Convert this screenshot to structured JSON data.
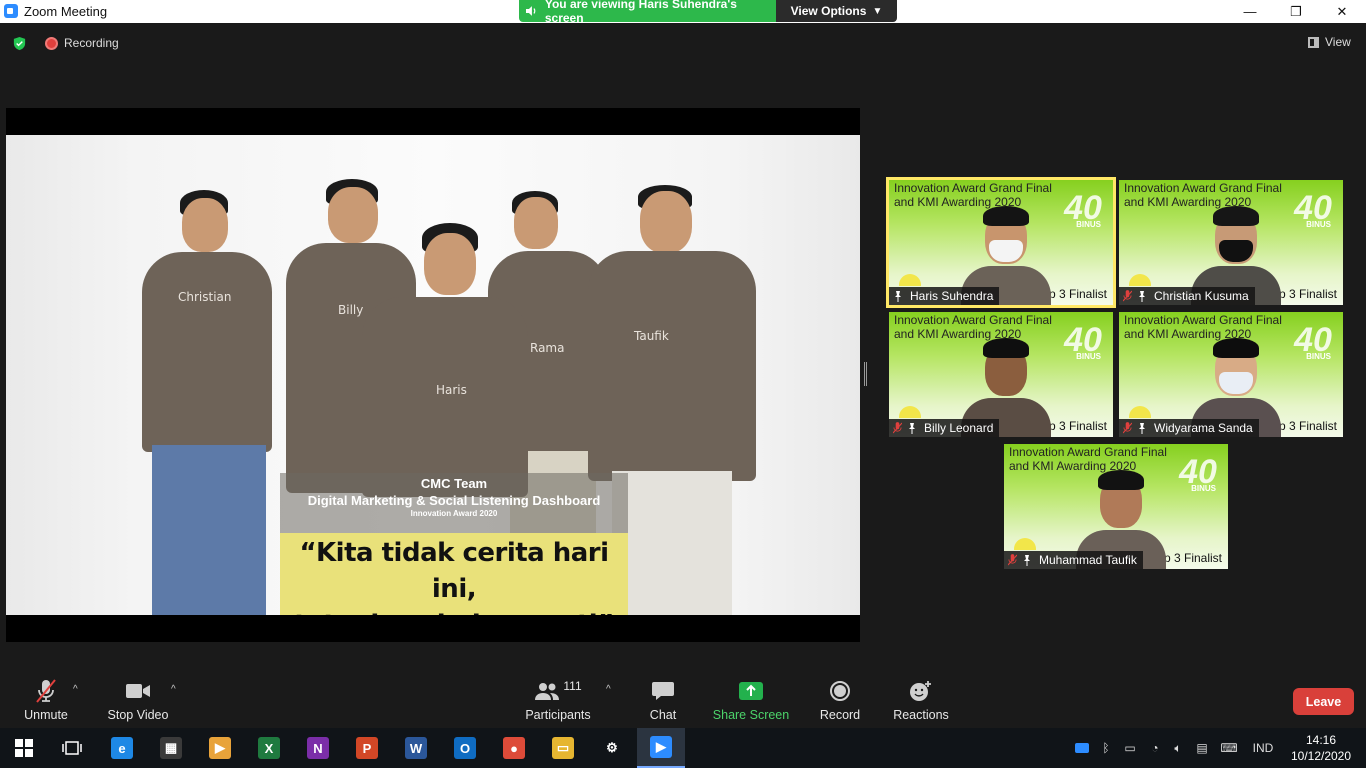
{
  "window": {
    "title": "Zoom Meeting",
    "controls": {
      "minimize": "—",
      "restore": "❐",
      "close": "✕"
    }
  },
  "share_banner": {
    "viewing_text": "You are viewing Haris Suhendra's screen",
    "view_options_label": "View Options",
    "caret": "⌄"
  },
  "status": {
    "recording_label": "Recording",
    "view_label": "View"
  },
  "shared_screen": {
    "people_labels": [
      "Christian",
      "Billy",
      "Haris",
      "Rama",
      "Taufik"
    ],
    "caption_line1": "CMC Team",
    "caption_line2": "Digital Marketing & Social Listening Dashboard",
    "caption_line3": "Innovation Award 2020",
    "quote_line1": "“Kita tidak cerita hari ini,",
    "quote_line2": "tetapi esok dan nanti”"
  },
  "tiles_common": {
    "bg_title_line1": "Innovation Award Grand Final",
    "bg_title_line2": "and KMI Awarding 2020",
    "logo": "40",
    "logo_sub": "BINUS",
    "finalist_text": "op 3 Finalist"
  },
  "participants_tiles": [
    {
      "name": "Haris Suhendra",
      "muted": false,
      "active": true
    },
    {
      "name": "Christian Kusuma",
      "muted": true,
      "active": false
    },
    {
      "name": "Billy Leonard",
      "muted": true,
      "active": false
    },
    {
      "name": "Widyarama Sanda",
      "muted": true,
      "active": false
    },
    {
      "name": "Muhammad Taufik",
      "muted": true,
      "active": false
    }
  ],
  "toolbar": {
    "unmute_label": "Unmute",
    "stop_video_label": "Stop Video",
    "participants_label": "Participants",
    "participants_count": "111",
    "chat_label": "Chat",
    "share_screen_label": "Share Screen",
    "record_label": "Record",
    "reactions_label": "Reactions",
    "leave_label": "Leave",
    "caret": "^"
  },
  "taskbar": {
    "apps": [
      {
        "name": "edge",
        "glyph": "e",
        "color": "#1e88e5"
      },
      {
        "name": "store",
        "glyph": "▦",
        "color": "#3a3a3a"
      },
      {
        "name": "media-player",
        "glyph": "▶",
        "color": "#e8a33a"
      },
      {
        "name": "excel",
        "glyph": "X",
        "color": "#1f7a3f"
      },
      {
        "name": "onenote",
        "glyph": "N",
        "color": "#7b2ea8"
      },
      {
        "name": "powerpoint",
        "glyph": "P",
        "color": "#d24726"
      },
      {
        "name": "word",
        "glyph": "W",
        "color": "#2b579a"
      },
      {
        "name": "outlook",
        "glyph": "O",
        "color": "#0f6cc2"
      },
      {
        "name": "chrome",
        "glyph": "●",
        "color": "#dd4b39"
      },
      {
        "name": "file-explorer",
        "glyph": "▭",
        "color": "#e6b631"
      },
      {
        "name": "settings",
        "glyph": "⚙",
        "color": "#101418"
      },
      {
        "name": "zoom",
        "glyph": "▶",
        "color": "#2d8cff"
      }
    ],
    "language": "IND",
    "time": "14:16",
    "date": "10/12/2020"
  }
}
